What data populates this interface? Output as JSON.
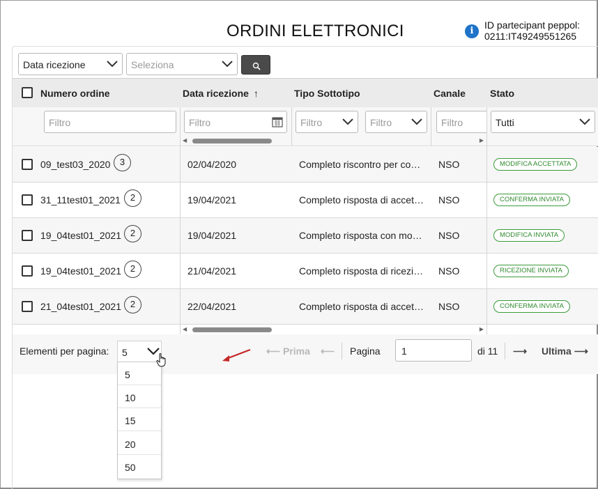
{
  "page": {
    "title": "ORDINI ELETTRONICI",
    "peppol_line1": "ID partecipant peppol:",
    "peppol_line2": "0211:IT49249551265"
  },
  "toolbar": {
    "date_field": "Data ricezione",
    "range_placeholder": "Seleziona"
  },
  "columns": {
    "numero": "Numero ordine",
    "data": "Data ricezione",
    "tipo": "Tipo Sottotipo",
    "canale": "Canale",
    "stato": "Stato",
    "sort_indicator": "↑"
  },
  "filters": {
    "placeholder": "Filtro",
    "stato_value": "Tutti"
  },
  "rows": [
    {
      "numero": "09_test03_2020",
      "count": "3",
      "data": "02/04/2020",
      "tipo": "Completo riscontro per co…",
      "canale": "NSO",
      "stato": "MODIFICA ACCETTATA"
    },
    {
      "numero": "31_11test01_2021",
      "count": "2",
      "data": "19/04/2021",
      "tipo": "Completo risposta di accet…",
      "canale": "NSO",
      "stato": "CONFERMA INVIATA"
    },
    {
      "numero": "19_04test01_2021",
      "count": "2",
      "data": "19/04/2021",
      "tipo": "Completo risposta con mo…",
      "canale": "NSO",
      "stato": "MODIFICA INVIATA"
    },
    {
      "numero": "19_04test01_2021",
      "count": "2",
      "data": "21/04/2021",
      "tipo": "Completo risposta di ricezi…",
      "canale": "NSO",
      "stato": "RICEZIONE INVIATA"
    },
    {
      "numero": "21_04test01_2021",
      "count": "2",
      "data": "22/04/2021",
      "tipo": "Completo risposta di accet…",
      "canale": "NSO",
      "stato": "CONFERMA INVIATA"
    }
  ],
  "pagination": {
    "per_page_label": "Elementi per pagina:",
    "per_page_value": "5",
    "options": [
      "5",
      "10",
      "15",
      "20",
      "50"
    ],
    "first": "Prima",
    "page_label": "Pagina",
    "page_value": "1",
    "of_label": "di 11",
    "last": "Ultima"
  },
  "colors": {
    "status_green": "#2f8a2f",
    "info_blue": "#1f73c9",
    "annotation_arrow": "#c62828"
  }
}
